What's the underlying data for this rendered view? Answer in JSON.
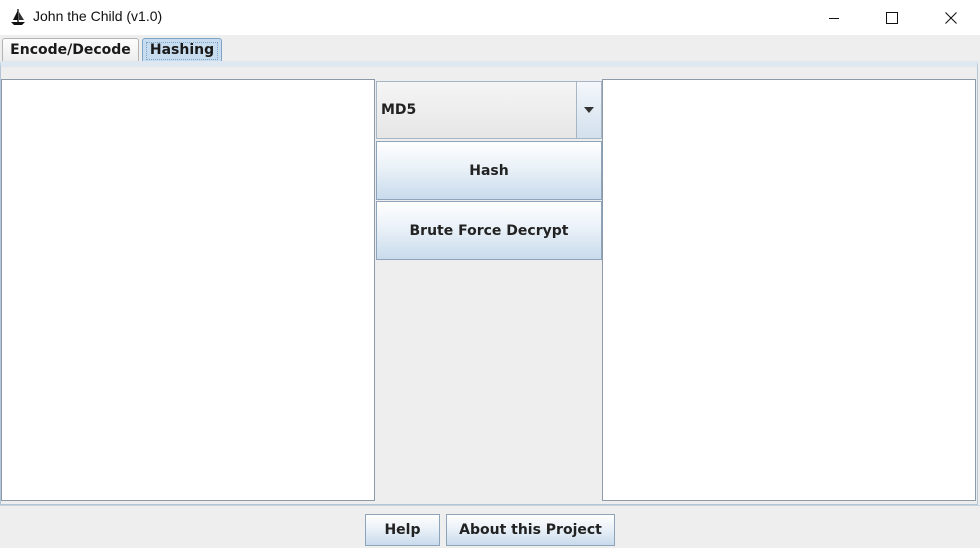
{
  "window": {
    "title": "John the Child (v1.0)",
    "icons": {
      "app": "ship-icon",
      "minimize": "minimize-icon",
      "maximize": "maximize-icon",
      "close": "close-icon"
    }
  },
  "tabs": [
    {
      "label": "Encode/Decode",
      "selected": false
    },
    {
      "label": "Hashing",
      "selected": true
    }
  ],
  "hashing": {
    "input_text": "",
    "output_text": "",
    "algorithm": {
      "selected": "MD5"
    },
    "hash_label": "Hash",
    "brute_force_label": "Brute Force Decrypt"
  },
  "footer": {
    "help_label": "Help",
    "about_label": "About this Project"
  },
  "colors": {
    "selected_tab": "#c7dcef",
    "button_gradient_bottom": "#c9dbec",
    "border": "#8d9aa7"
  }
}
